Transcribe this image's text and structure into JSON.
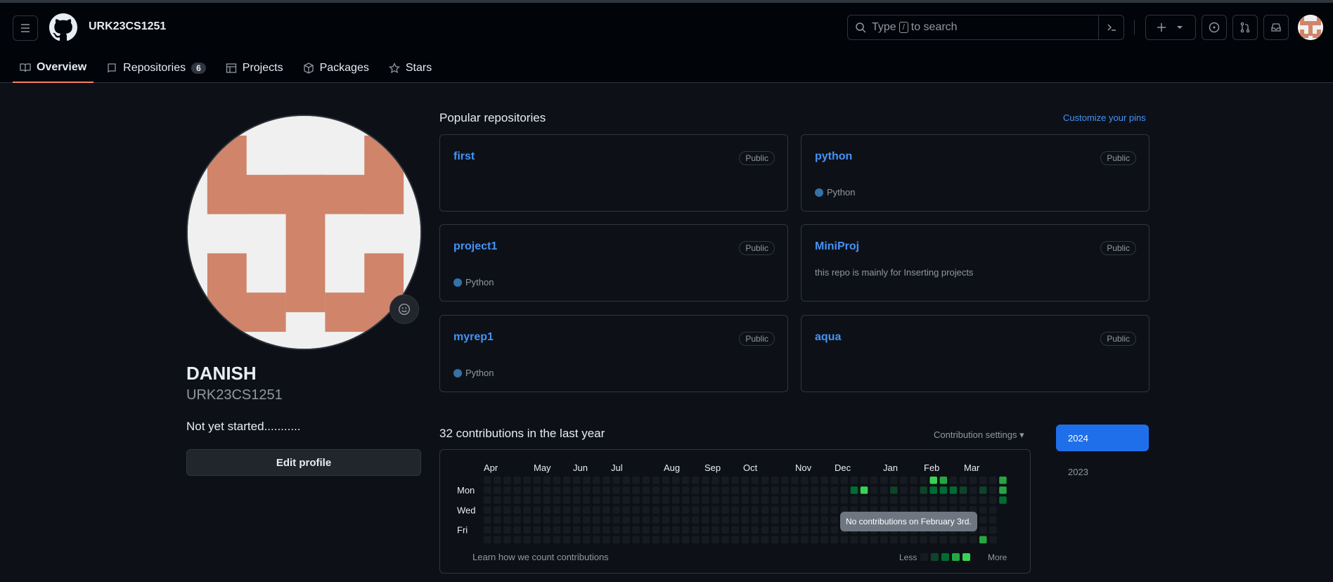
{
  "header": {
    "username": "URK23CS1251",
    "search_placeholder_pre": "Type",
    "search_slash": "/",
    "search_placeholder_post": "to search"
  },
  "nav": {
    "tabs": [
      {
        "label": "Overview",
        "icon": "book-icon",
        "active": true
      },
      {
        "label": "Repositories",
        "icon": "repo-icon",
        "count": "6"
      },
      {
        "label": "Projects",
        "icon": "table-icon"
      },
      {
        "label": "Packages",
        "icon": "package-icon"
      },
      {
        "label": "Stars",
        "icon": "star-icon"
      }
    ]
  },
  "profile": {
    "name": "DANISH",
    "login": "URK23CS1251",
    "bio": "Not yet started...........",
    "edit_label": "Edit profile"
  },
  "popular": {
    "title": "Popular repositories",
    "customize": "Customize your pins",
    "repos": [
      {
        "name": "first",
        "visibility": "Public"
      },
      {
        "name": "python",
        "visibility": "Public",
        "language": "Python"
      },
      {
        "name": "project1",
        "visibility": "Public",
        "language": "Python"
      },
      {
        "name": "MiniProj",
        "visibility": "Public",
        "description": "this repo is mainly for Inserting projects"
      },
      {
        "name": "myrep1",
        "visibility": "Public",
        "language": "Python"
      },
      {
        "name": "aqua",
        "visibility": "Public"
      }
    ]
  },
  "contributions": {
    "title": "32 contributions in the last year",
    "settings": "Contribution settings ▾",
    "months": [
      "Apr",
      "May",
      "Jun",
      "Jul",
      "Aug",
      "Sep",
      "Oct",
      "Nov",
      "Dec",
      "Jan",
      "Feb",
      "Mar"
    ],
    "days": [
      "Mon",
      "Wed",
      "Fri"
    ],
    "learn": "Learn how we count contributions",
    "less": "Less",
    "more": "More",
    "tooltip": "No contributions on February 3rd.",
    "colors": {
      "empty": "#161b22",
      "l1": "#0e4429",
      "l2": "#006d32",
      "l3": "#26a641",
      "l4": "#39d353"
    }
  },
  "years": {
    "active": "2024",
    "other": "2023"
  }
}
